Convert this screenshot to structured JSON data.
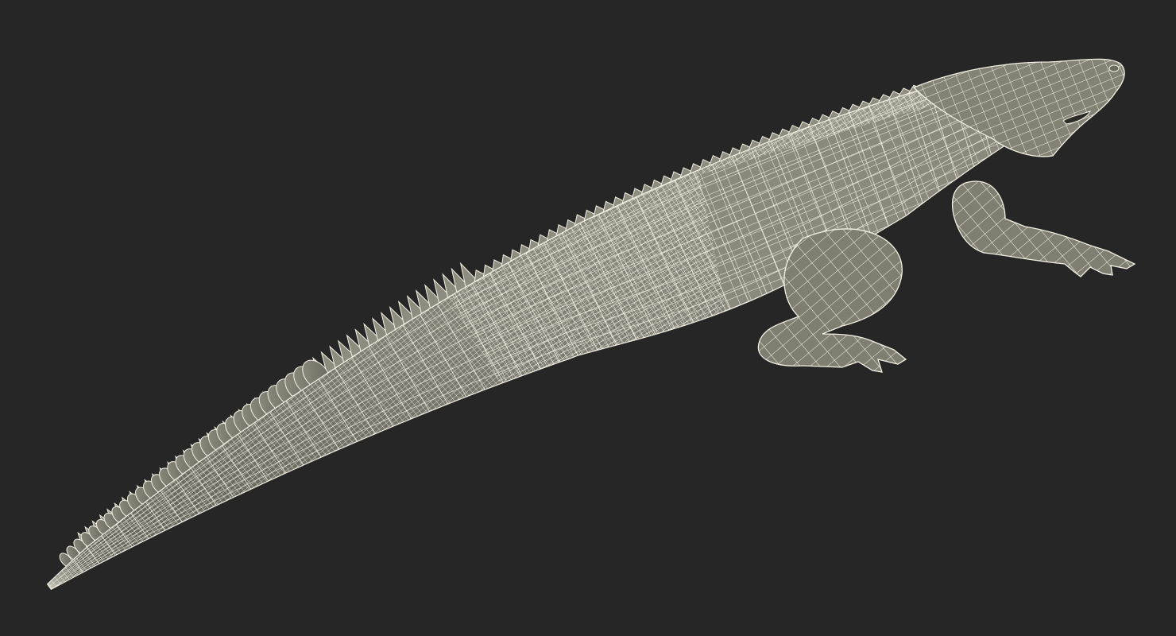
{
  "scene": {
    "subject": "crocodile-wireframe-model",
    "render_style": "wireframe-over-clay",
    "colors": {
      "background": "#262626",
      "surface": "#7d7c70",
      "surface_shadow": "#5a594f",
      "surface_highlight": "#9a998b",
      "wire": "#f4f1e4"
    }
  }
}
